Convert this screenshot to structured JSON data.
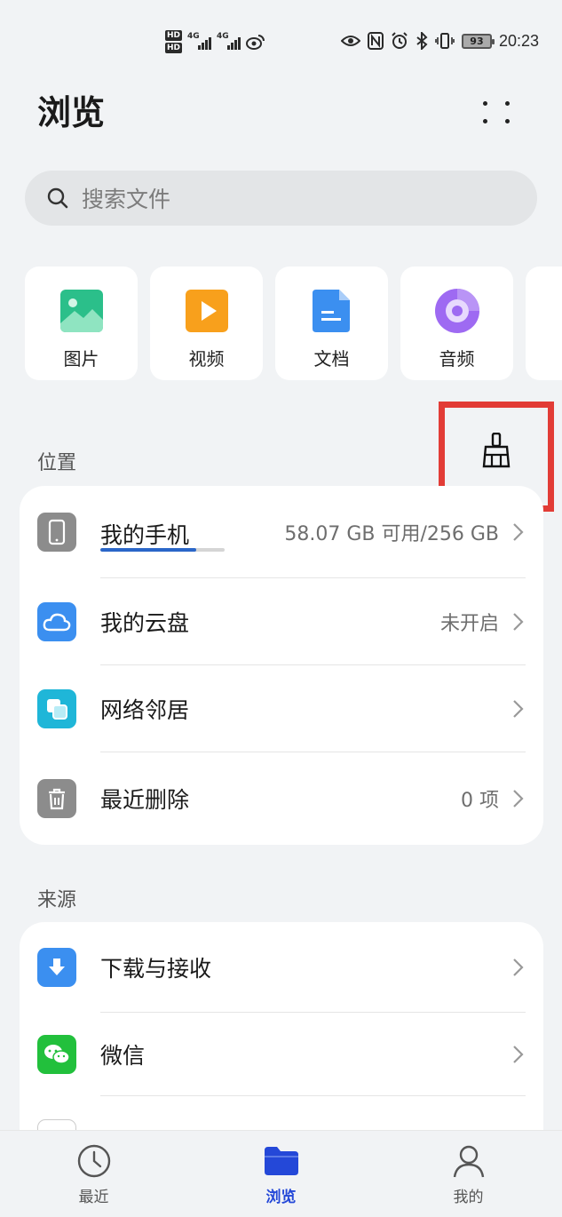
{
  "status_bar": {
    "hd_top": "HD",
    "hd_bottom": "HD",
    "net1": "4G",
    "net2": "4G",
    "battery": "93",
    "time": "20:23"
  },
  "header": {
    "title": "浏览"
  },
  "search": {
    "placeholder": "搜索文件"
  },
  "categories": [
    {
      "label": "图片",
      "icon": "image-icon",
      "color": "#2bbf8a"
    },
    {
      "label": "视频",
      "icon": "video-icon",
      "color": "#f8a01c"
    },
    {
      "label": "文档",
      "icon": "document-icon",
      "color": "#3b8ff0"
    },
    {
      "label": "音频",
      "icon": "audio-icon",
      "color": "#9e6af2"
    }
  ],
  "locations": {
    "section_label": "位置",
    "items": [
      {
        "label": "我的手机",
        "value": "58.07 GB 可用/256 GB",
        "icon": "phone-icon",
        "storage_used_fraction": 0.77
      },
      {
        "label": "我的云盘",
        "value": "未开启",
        "icon": "cloud-icon"
      },
      {
        "label": "网络邻居",
        "value": "",
        "icon": "network-icon"
      },
      {
        "label": "最近删除",
        "value": "0 项",
        "icon": "trash-icon"
      }
    ]
  },
  "sources": {
    "section_label": "来源",
    "items": [
      {
        "label": "下载与接收",
        "icon": "download-icon"
      },
      {
        "label": "微信",
        "icon": "wechat-icon"
      }
    ]
  },
  "bottom_nav": [
    {
      "label": "最近",
      "icon": "clock-icon",
      "active": false
    },
    {
      "label": "浏览",
      "icon": "folder-icon",
      "active": true
    },
    {
      "label": "我的",
      "icon": "person-icon",
      "active": false
    }
  ],
  "colors": {
    "accent": "#2448d8",
    "highlight_box": "#e23c36",
    "background": "#f1f3f5"
  }
}
